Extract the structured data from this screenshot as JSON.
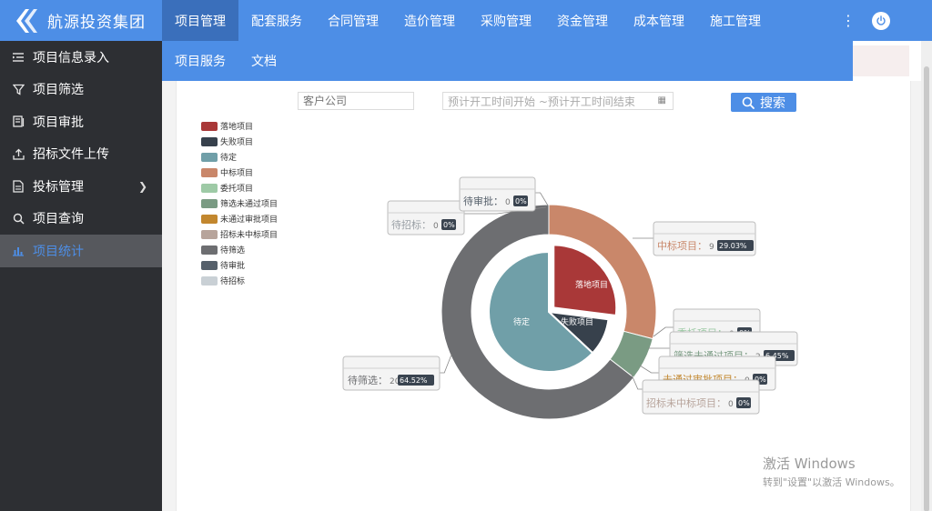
{
  "brand": {
    "name": "航源投资集团"
  },
  "sidebar": {
    "items": [
      {
        "label": "项目信息录入",
        "icon": "list-indent-icon"
      },
      {
        "label": "项目筛选",
        "icon": "filter-icon"
      },
      {
        "label": "项目审批",
        "icon": "approval-icon"
      },
      {
        "label": "招标文件上传",
        "icon": "upload-icon"
      },
      {
        "label": "投标管理",
        "icon": "document-icon"
      },
      {
        "label": "项目查询",
        "icon": "search-icon"
      },
      {
        "label": "项目统计",
        "icon": "bar-chart-icon"
      }
    ],
    "active_index": 6
  },
  "topnav": {
    "tabs": [
      "项目管理",
      "配套服务",
      "合同管理",
      "造价管理",
      "采购管理",
      "资金管理",
      "成本管理",
      "施工管理"
    ],
    "active_index": 0
  },
  "subnav": {
    "tabs": [
      "项目服务",
      "文档"
    ]
  },
  "search": {
    "customer_placeholder": "客户公司",
    "date_range_placeholder": "预计开工时间开始 ~预计开工时间结束",
    "button_label": "搜索"
  },
  "colors": {
    "accent": "#4d8ee6",
    "sidebar_bg": "#2d2f33"
  },
  "watermark": {
    "line1": "激活 Windows",
    "line2": "转到\"设置\"以激活 Windows。"
  },
  "chart_data": {
    "type": "pie",
    "legend_position": "left",
    "legend": [
      {
        "name": "落地项目",
        "color": "#a93838"
      },
      {
        "name": "失败项目",
        "color": "#37414c"
      },
      {
        "name": "待定",
        "color": "#709fa8"
      },
      {
        "name": "中标项目",
        "color": "#c9876a"
      },
      {
        "name": "委托项目",
        "color": "#9ecaa6"
      },
      {
        "name": "筛选未通过项目",
        "color": "#7a9b83"
      },
      {
        "name": "未通过审批项目",
        "color": "#c2872e"
      },
      {
        "name": "招标未中标项目",
        "color": "#b7a49b"
      },
      {
        "name": "待筛选",
        "color": "#6d6e71"
      },
      {
        "name": "待审批",
        "color": "#56606b"
      },
      {
        "name": "待招标",
        "color": "#c9d0d5"
      }
    ],
    "inner": [
      {
        "name": "落地项目",
        "value": 27,
        "color": "#a93838"
      },
      {
        "name": "失败项目",
        "value": 10,
        "color": "#37414c"
      },
      {
        "name": "待定",
        "value": 63,
        "color": "#709fa8"
      }
    ],
    "outer": [
      {
        "name": "中标项目",
        "value": 9,
        "percent": "29.03%",
        "color": "#c9876a"
      },
      {
        "name": "委托项目",
        "value": 0,
        "percent": "0%",
        "color": "#9ecaa6"
      },
      {
        "name": "筛选未通过项目",
        "value": 2,
        "percent": "6.45%",
        "color": "#7a9b83"
      },
      {
        "name": "未通过审批项目",
        "value": 0,
        "percent": "0%",
        "color": "#c2872e"
      },
      {
        "name": "招标未中标项目",
        "value": 0,
        "percent": "0%",
        "color": "#b7a49b"
      },
      {
        "name": "待筛选",
        "value": 20,
        "percent": "64.52%",
        "color": "#6d6e71"
      },
      {
        "name": "待审批",
        "value": 0,
        "percent": "0%",
        "color": "#56606b"
      },
      {
        "name": "待招标",
        "value": 0,
        "percent": "0%",
        "color": "#c9d0d5"
      }
    ]
  }
}
